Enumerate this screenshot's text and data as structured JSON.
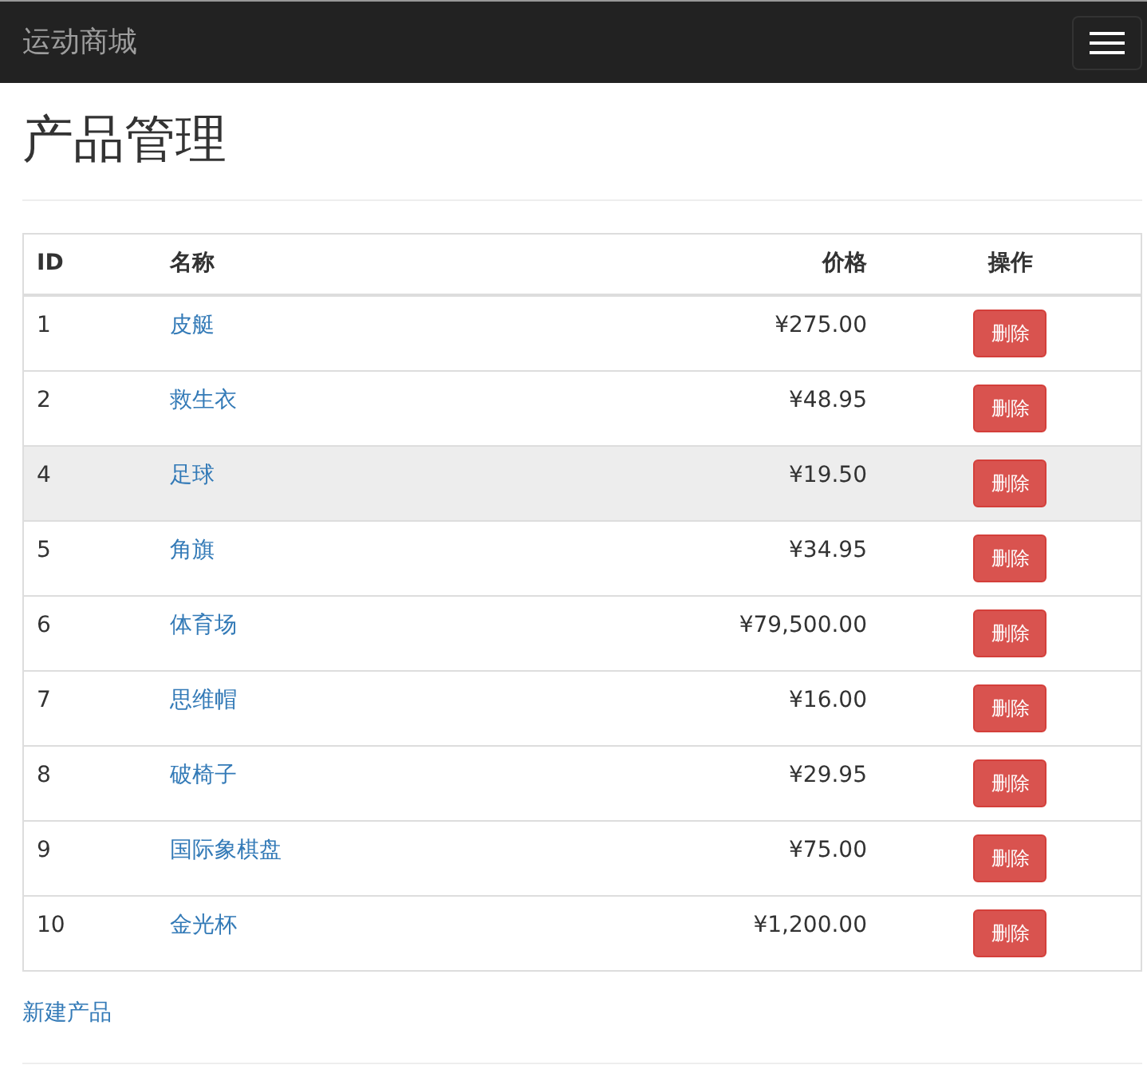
{
  "navbar": {
    "brand": "运动商城"
  },
  "page_title": "产品管理",
  "table": {
    "columns": [
      "ID",
      "名称",
      "价格",
      "操作"
    ],
    "rows": [
      {
        "id": "1",
        "name": "皮艇",
        "price": "¥275.00",
        "action": "删除",
        "selected": false
      },
      {
        "id": "2",
        "name": "救生衣",
        "price": "¥48.95",
        "action": "删除",
        "selected": false
      },
      {
        "id": "4",
        "name": "足球",
        "price": "¥19.50",
        "action": "删除",
        "selected": true
      },
      {
        "id": "5",
        "name": "角旗",
        "price": "¥34.95",
        "action": "删除",
        "selected": false
      },
      {
        "id": "6",
        "name": "体育场",
        "price": "¥79,500.00",
        "action": "删除",
        "selected": false
      },
      {
        "id": "7",
        "name": "思维帽",
        "price": "¥16.00",
        "action": "删除",
        "selected": false
      },
      {
        "id": "8",
        "name": "破椅子",
        "price": "¥29.95",
        "action": "删除",
        "selected": false
      },
      {
        "id": "9",
        "name": "国际象棋盘",
        "price": "¥75.00",
        "action": "删除",
        "selected": false
      },
      {
        "id": "10",
        "name": "金光杯",
        "price": "¥1,200.00",
        "action": "删除",
        "selected": false
      }
    ]
  },
  "new_link": "新建产品"
}
